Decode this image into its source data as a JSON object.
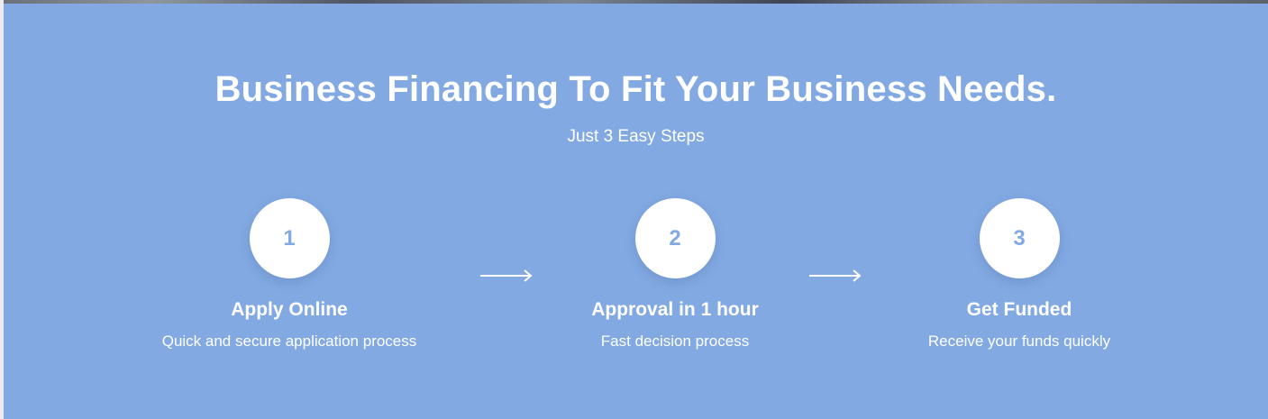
{
  "hero": {
    "title": "Business Financing To Fit Your Business Needs.",
    "subtitle": "Just 3 Easy Steps",
    "background_color": "#82a9e2",
    "steps": [
      {
        "number": "1",
        "title": "Apply Online",
        "description": "Quick and secure application process"
      },
      {
        "number": "2",
        "title": "Approval in 1 hour",
        "description": "Fast decision process"
      },
      {
        "number": "3",
        "title": "Get Funded",
        "description": "Receive your funds quickly"
      }
    ],
    "arrow_icon": "arrow-right-icon"
  }
}
